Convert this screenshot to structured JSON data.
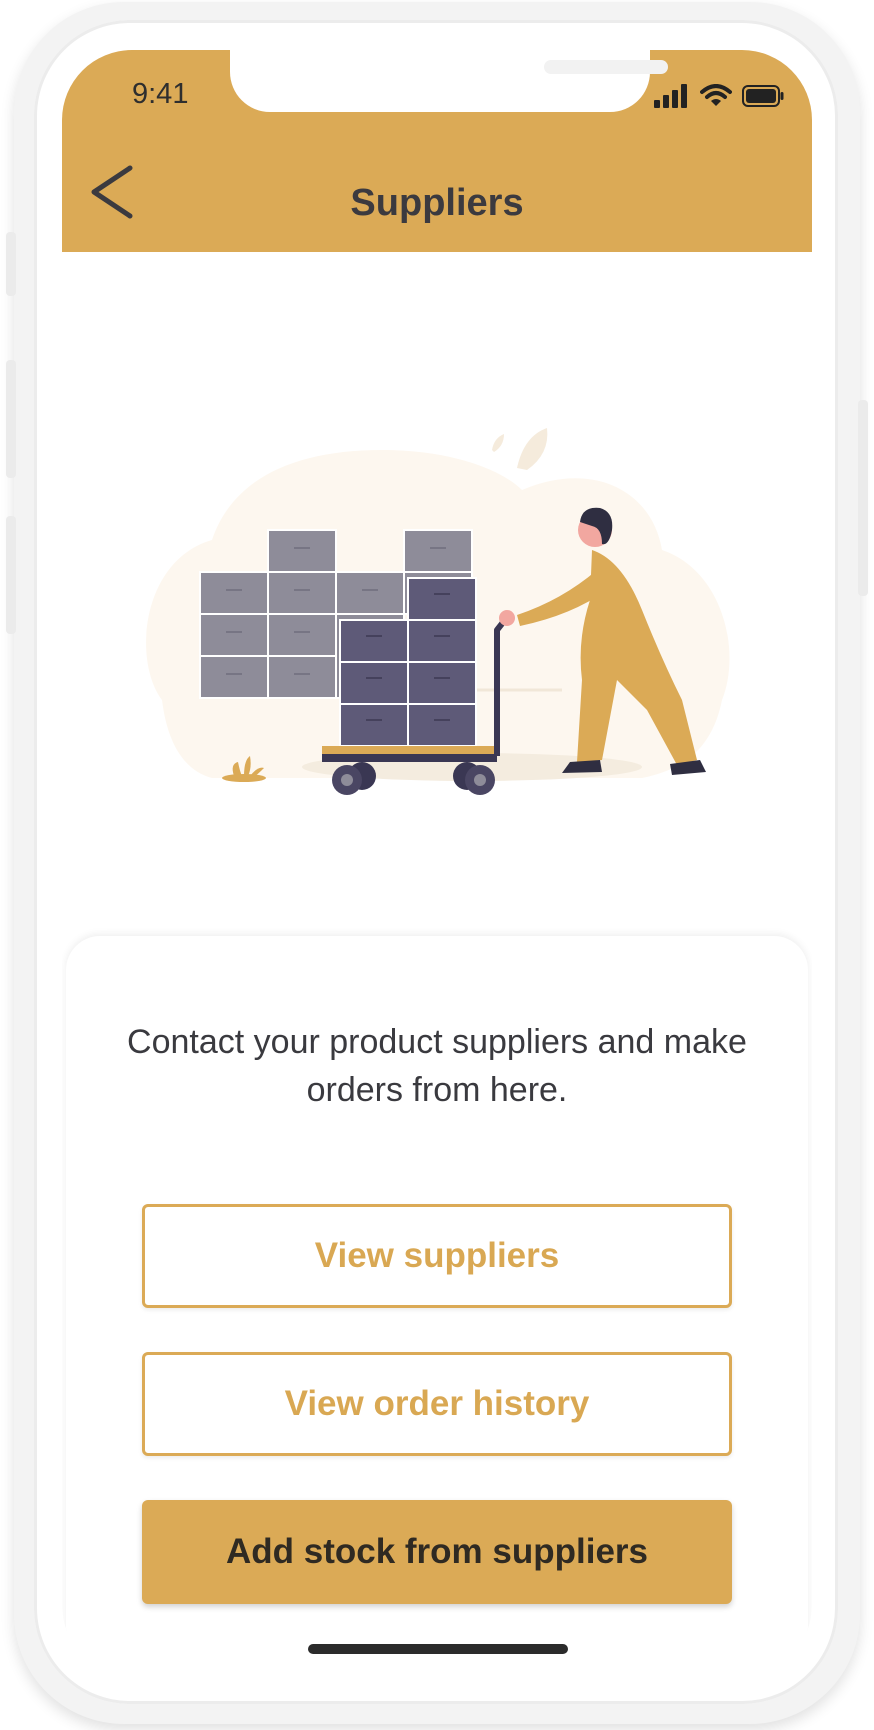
{
  "status_bar": {
    "time": "9:41"
  },
  "header": {
    "title": "Suppliers"
  },
  "main": {
    "description": "Contact your product suppliers and make orders from here.",
    "buttons": {
      "view_suppliers": "View suppliers",
      "view_order_history": "View order history",
      "add_stock": "Add stock from suppliers"
    }
  },
  "icons": {
    "back": "chevron-left-icon",
    "signal": "cellular-signal-icon",
    "wifi": "wifi-icon",
    "battery": "battery-icon"
  },
  "colors": {
    "accent": "#dbaa56",
    "text_dark": "#3b3a3f",
    "box_gray": "#8e8c99",
    "box_dark": "#5e5a78"
  }
}
